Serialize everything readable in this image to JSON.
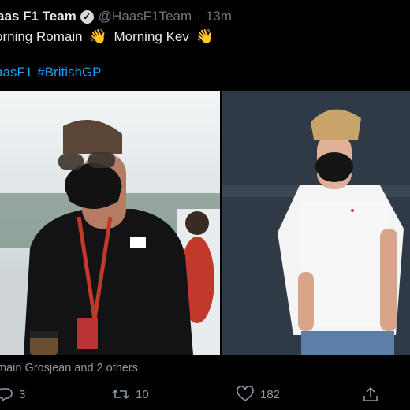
{
  "tweet": {
    "display_name": "aas F1 Team",
    "handle": "@HaasF1Team",
    "separator": "·",
    "time": "13m",
    "line1_part1": "orning Romain",
    "line1_part2": "Morning Kev",
    "hashtags": [
      "aasF1",
      "#BritishGP"
    ],
    "tagged_people": "main Grosjean and 2 others",
    "reply_count": "3",
    "retweet_count": "10",
    "like_count": "182"
  },
  "icons": {
    "verified": "verified-badge-icon",
    "wave": "waving-hand-icon",
    "reply": "reply-icon",
    "retweet": "retweet-icon",
    "like": "heart-icon",
    "share": "share-icon"
  },
  "colors": {
    "background": "#000000",
    "text": "#e7e9ea",
    "muted": "#71767b",
    "link": "#1d9bf0"
  }
}
